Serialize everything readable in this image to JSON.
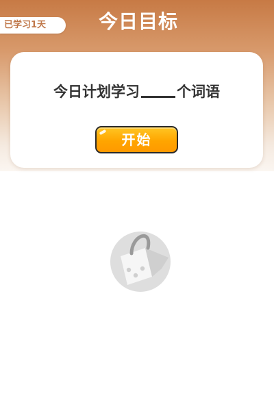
{
  "header": {
    "title": "今日目标",
    "days_badge": "已学习1天"
  },
  "goal_card": {
    "prefix": "今日计划学习",
    "suffix": "个词语",
    "blank_value": "",
    "start_button_label": "开始"
  },
  "loading": {
    "icon": "loading-bag-icon"
  },
  "colors": {
    "header_gradient_top": "#c77a45",
    "badge_text": "#c0784a",
    "button_orange": "#ffa500",
    "text_dark": "#333333",
    "icon_gray": "#dddddd"
  }
}
